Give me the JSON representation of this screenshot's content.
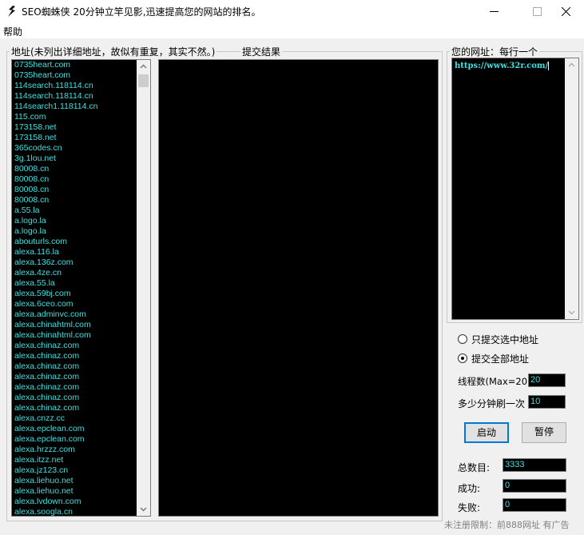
{
  "window": {
    "title": "SEO蜘蛛侠  20分钟立竿见影,迅速提高您的网站的排名。"
  },
  "menu": {
    "help": "帮助"
  },
  "address_panel": {
    "legend": "地址(未列出详细地址，故似有重复，其实不然。)",
    "items": [
      "0735heart.com",
      "0735heart.com",
      "114search.118114.cn",
      "114search.118114.cn",
      "114search1.118114.cn",
      "115.com",
      "173158.net",
      "173158.net",
      "365codes.cn",
      "3g.1lou.net",
      "80008.cn",
      "80008.cn",
      "80008.cn",
      "80008.cn",
      "a.55.la",
      "a.logo.la",
      "a.logo.la",
      "abouturls.com",
      "alexa.116.la",
      "alexa.136z.com",
      "alexa.4ze.cn",
      "alexa.55.la",
      "alexa.59bj.com",
      "alexa.6ceo.com",
      "alexa.adminvc.com",
      "alexa.chinahtml.com",
      "alexa.chinahtml.com",
      "alexa.chinaz.com",
      "alexa.chinaz.com",
      "alexa.chinaz.com",
      "alexa.chinaz.com",
      "alexa.chinaz.com",
      "alexa.chinaz.com",
      "alexa.chinaz.com",
      "alexa.cnzz.cc",
      "alexa.epclean.com",
      "alexa.epclean.com",
      "alexa.hrzzz.com",
      "alexa.itzz.net",
      "alexa.jz123.cn",
      "alexa.liehuo.net",
      "alexa.liehuo.net",
      "alexa.lvdown.com",
      "alexa.soogla.cn"
    ]
  },
  "result_panel": {
    "legend": "提交结果"
  },
  "url_panel": {
    "legend": "您的网址：每行一个",
    "value": "https://www.32r.com/"
  },
  "options": {
    "submit_selected": "只提交选中地址",
    "submit_all": "提交全部地址",
    "selected_mode": "submit_all"
  },
  "settings": {
    "threads_label": "线程数(Max=20):",
    "threads_value": "20",
    "refresh_label": "多少分钟刷一次",
    "refresh_value": "10"
  },
  "buttons": {
    "start": "启动",
    "pause": "暂停"
  },
  "stats": {
    "total_label": "总数目:",
    "total_value": "3333",
    "success_label": "成功:",
    "success_value": "0",
    "fail_label": "失败:",
    "fail_value": "0"
  },
  "footer": {
    "notice": "未注册限制：前888网址 有广告"
  },
  "colors": {
    "list_text": "#3fe0e0",
    "box_bg": "#000000",
    "accent": "#0078d7"
  }
}
